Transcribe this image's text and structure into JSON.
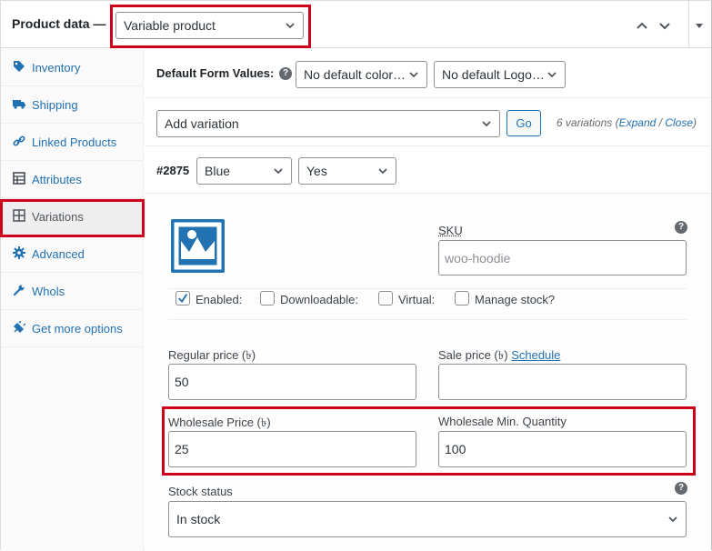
{
  "header": {
    "title": "Product data —",
    "product_type": "Variable product",
    "collapse_up_icon": "chevron-up",
    "collapse_down_icon": "chevron-down",
    "toggle_icon": "triangle-down"
  },
  "sidebar": {
    "items": [
      {
        "label": "Inventory",
        "icon": "tag-icon"
      },
      {
        "label": "Shipping",
        "icon": "truck-icon"
      },
      {
        "label": "Linked Products",
        "icon": "link-icon"
      },
      {
        "label": "Attributes",
        "icon": "table-icon"
      },
      {
        "label": "Variations",
        "icon": "grid-icon",
        "active": true
      },
      {
        "label": "Advanced",
        "icon": "gear-icon"
      },
      {
        "label": "Whols",
        "icon": "wrench-icon"
      },
      {
        "label": "Get more options",
        "icon": "plugin-icon"
      }
    ]
  },
  "defaults": {
    "label": "Default Form Values:",
    "color_select": "No default color…",
    "logo_select": "No default Logo…"
  },
  "variations_bar": {
    "action_select": "Add variation",
    "go_label": "Go",
    "count_text": "6 variations (",
    "expand": "Expand",
    "slash": " / ",
    "close": "Close",
    "close_paren": ")"
  },
  "variation": {
    "id": "#2875",
    "attr_color": "Blue",
    "attr_logo": "Yes",
    "sku_label": "SKU",
    "sku_placeholder": "woo-hoodie",
    "enabled_label": "Enabled:",
    "downloadable_label": "Downloadable:",
    "virtual_label": "Virtual:",
    "manage_stock_label": "Manage stock?",
    "enabled_checked": true,
    "regular_price_label": "Regular price (৳)",
    "regular_price": "50",
    "sale_price_label": "Sale price (৳)",
    "schedule_label": "Schedule",
    "sale_price": "",
    "wholesale_price_label": "Wholesale Price (৳)",
    "wholesale_price": "25",
    "wholesale_min_label": "Wholesale Min. Quantity",
    "wholesale_min": "100",
    "stock_status_label": "Stock status",
    "stock_status": "In stock"
  },
  "colors": {
    "highlight": "#d0021b",
    "link": "#2271b1",
    "thumb": "#2271b1"
  }
}
